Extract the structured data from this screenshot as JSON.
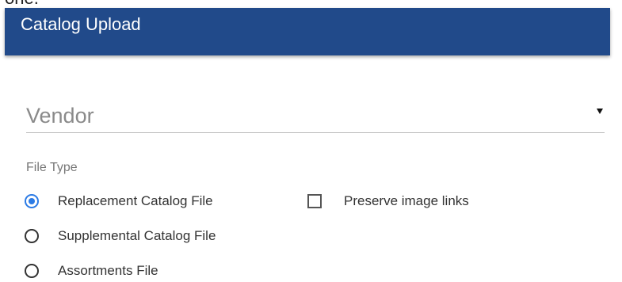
{
  "page_top_cutoff_text": "one.",
  "header": {
    "title": "Catalog Upload"
  },
  "vendor": {
    "label": "Vendor"
  },
  "file_type": {
    "label": "File Type",
    "options": [
      {
        "label": "Replacement Catalog File",
        "selected": true
      },
      {
        "label": "Supplemental Catalog File",
        "selected": false
      },
      {
        "label": "Assortments File",
        "selected": false
      }
    ]
  },
  "preserve_image_links": {
    "label": "Preserve image links",
    "checked": false
  },
  "colors": {
    "header_bg": "#214a8a",
    "accent": "#2c7be5"
  },
  "icons": {
    "vendor_dropdown": "caret-down-icon"
  }
}
